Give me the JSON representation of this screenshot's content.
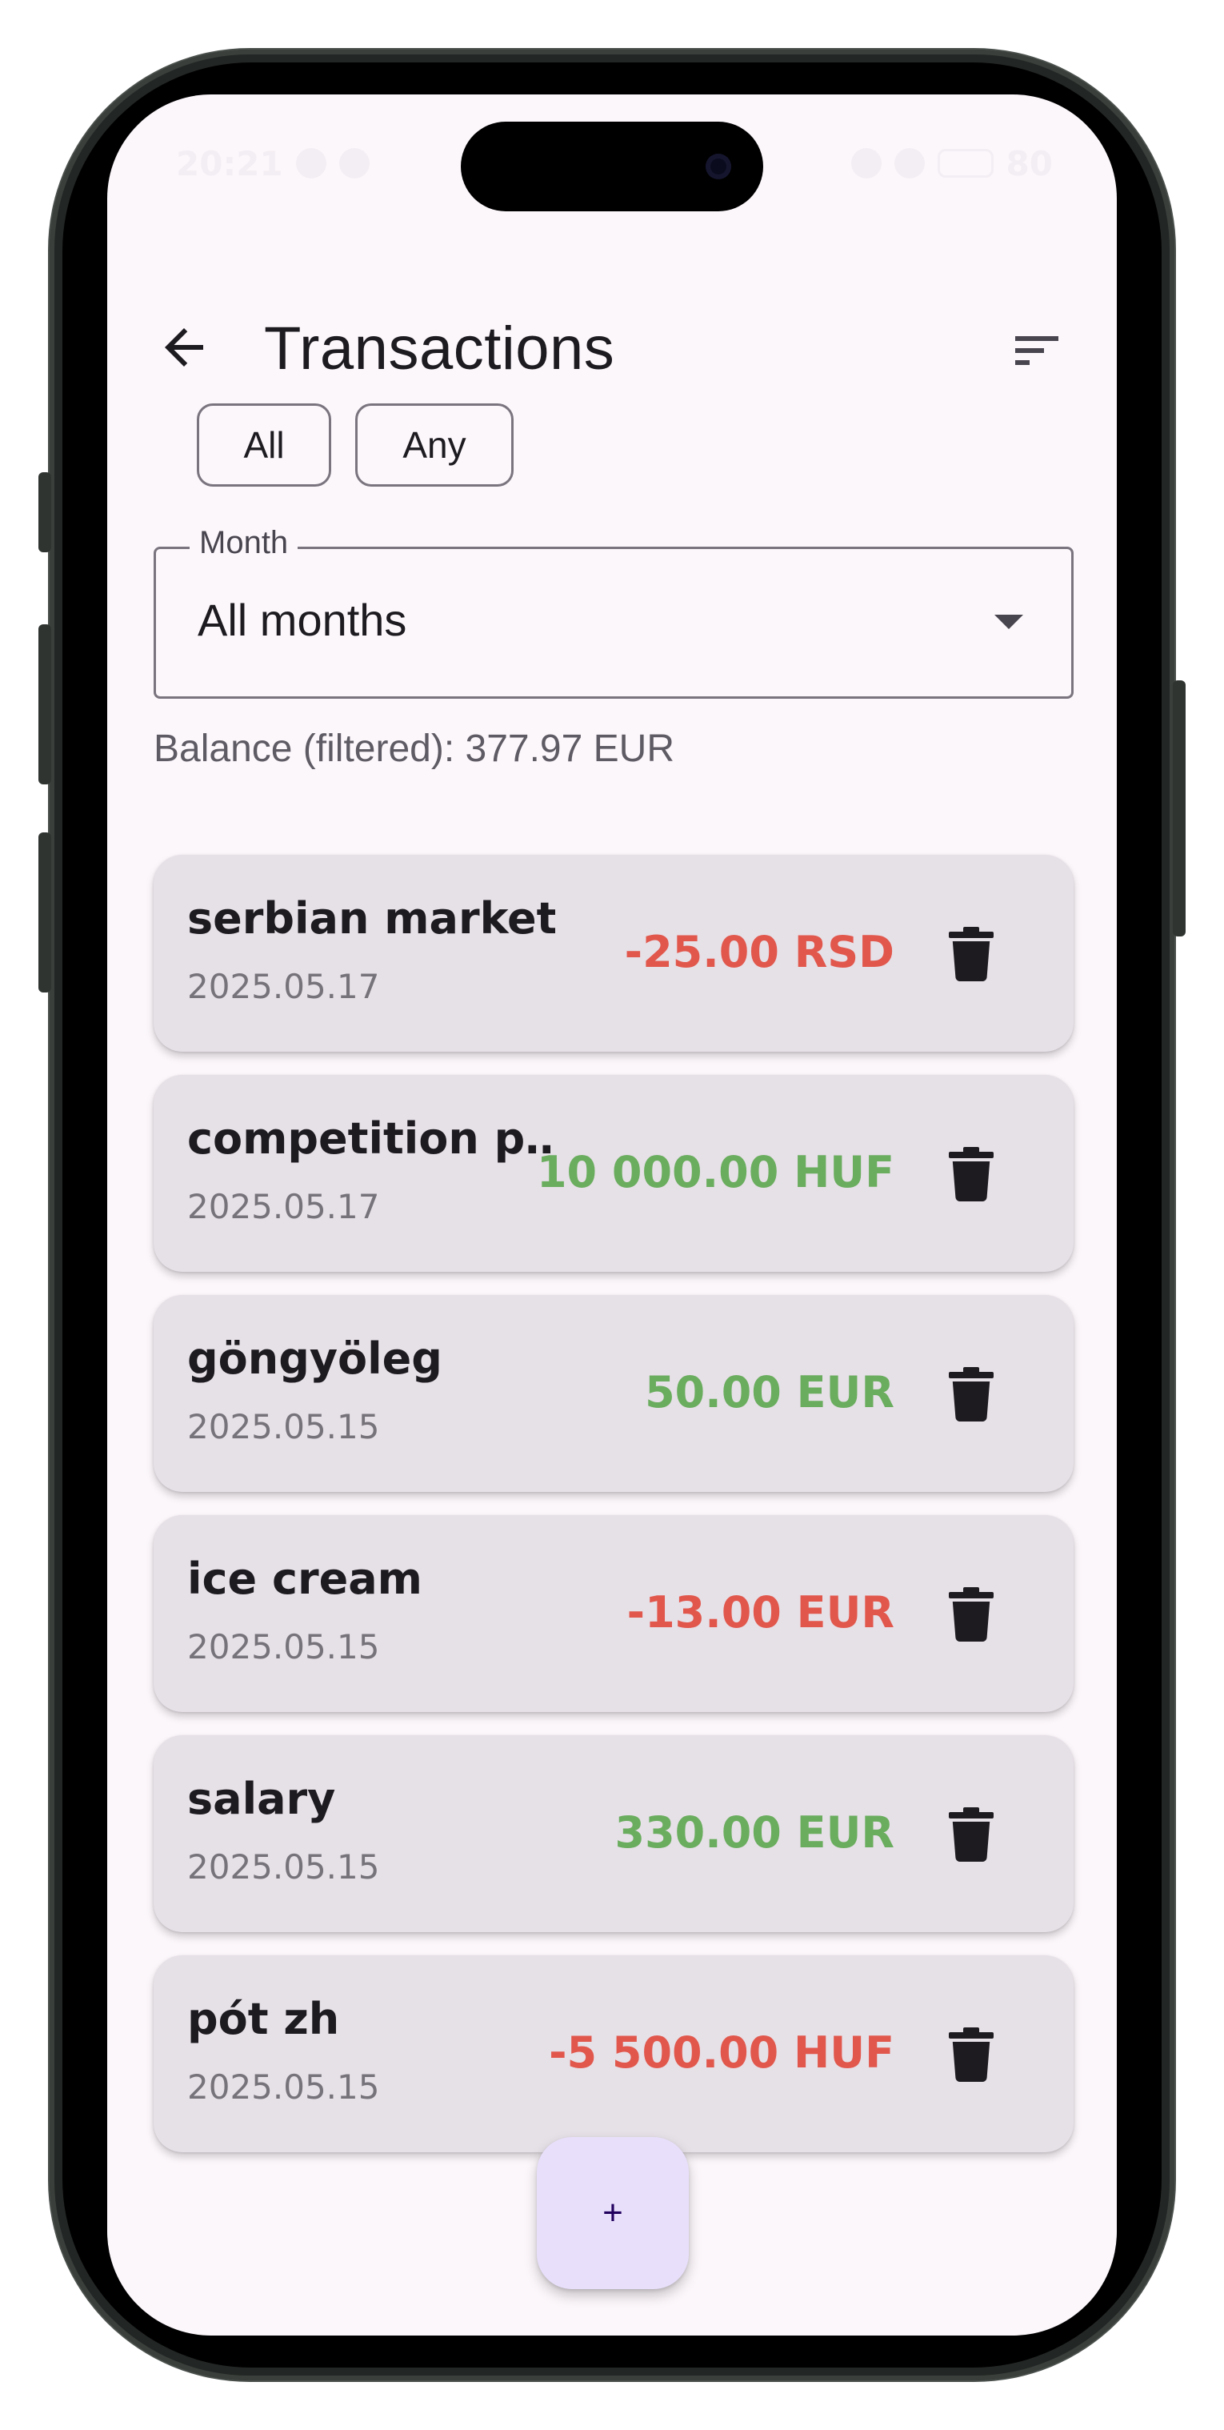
{
  "status_bar": {
    "time": "20:21",
    "battery": "80"
  },
  "app_bar": {
    "title": "Transactions",
    "back_icon": "arrow-back-icon",
    "sort_icon": "sort-icon"
  },
  "filters": {
    "chips": [
      "All",
      "Any"
    ],
    "month": {
      "label": "Month",
      "value": "All months"
    }
  },
  "balance": {
    "text": "Balance (filtered): 377.97 EUR"
  },
  "transactions": [
    {
      "name": "serbian market",
      "date": "2025.05.17",
      "amount": "-25.00 RSD",
      "type": "expense"
    },
    {
      "name": "competition p…",
      "date": "2025.05.17",
      "amount": "10 000.00 HUF",
      "type": "income"
    },
    {
      "name": "göngyöleg",
      "date": "2025.05.15",
      "amount": "50.00 EUR",
      "type": "income"
    },
    {
      "name": "ice cream",
      "date": "2025.05.15",
      "amount": "-13.00 EUR",
      "type": "expense"
    },
    {
      "name": "salary",
      "date": "2025.05.15",
      "amount": "330.00 EUR",
      "type": "income"
    },
    {
      "name": "pót zh",
      "date": "2025.05.15",
      "amount": "-5 500.00 HUF",
      "type": "expense"
    }
  ],
  "fab": {
    "label": "+"
  },
  "colors": {
    "expense": "#e1574c",
    "income": "#6aad5e",
    "card": "#e6e0e7",
    "fab": "#e8dffb",
    "background": "#fcf7fb"
  }
}
